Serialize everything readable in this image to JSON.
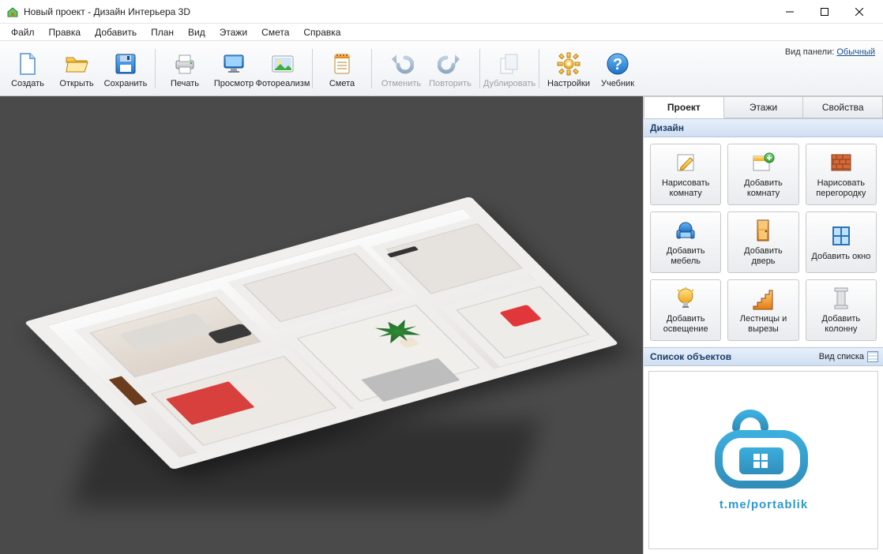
{
  "window": {
    "title": "Новый проект - Дизайн Интерьера 3D"
  },
  "menu": {
    "items": [
      {
        "label": "Файл"
      },
      {
        "label": "Правка"
      },
      {
        "label": "Добавить"
      },
      {
        "label": "План"
      },
      {
        "label": "Вид"
      },
      {
        "label": "Этажи"
      },
      {
        "label": "Смета"
      },
      {
        "label": "Справка"
      }
    ]
  },
  "toolbar": {
    "panel_mode_label": "Вид панели:",
    "panel_mode_value": "Обычный",
    "buttons": [
      {
        "id": "create",
        "label": "Создать",
        "icon": "file-new",
        "enabled": true
      },
      {
        "id": "open",
        "label": "Открыть",
        "icon": "folder-open",
        "enabled": true
      },
      {
        "id": "save",
        "label": "Сохранить",
        "icon": "floppy",
        "enabled": true
      },
      {
        "id": "sep"
      },
      {
        "id": "print",
        "label": "Печать",
        "icon": "printer",
        "enabled": true
      },
      {
        "id": "preview",
        "label": "Просмотр",
        "icon": "monitor",
        "enabled": true
      },
      {
        "id": "photoreal",
        "label": "Фотореализм",
        "icon": "photo",
        "enabled": true
      },
      {
        "id": "sep"
      },
      {
        "id": "estimate",
        "label": "Смета",
        "icon": "notepad",
        "enabled": true
      },
      {
        "id": "sep"
      },
      {
        "id": "undo",
        "label": "Отменить",
        "icon": "undo",
        "enabled": false
      },
      {
        "id": "redo",
        "label": "Повторить",
        "icon": "redo",
        "enabled": false
      },
      {
        "id": "sep"
      },
      {
        "id": "duplicate",
        "label": "Дублировать",
        "icon": "duplicate",
        "enabled": false
      },
      {
        "id": "sep"
      },
      {
        "id": "settings",
        "label": "Настройки",
        "icon": "gear",
        "enabled": true
      },
      {
        "id": "tutorial",
        "label": "Учебник",
        "icon": "help",
        "enabled": true
      }
    ]
  },
  "sidepanel": {
    "tabs": [
      {
        "label": "Проект",
        "active": true
      },
      {
        "label": "Этажи",
        "active": false
      },
      {
        "label": "Свойства",
        "active": false
      }
    ],
    "design_header": "Дизайн",
    "design_buttons": [
      {
        "id": "draw-room",
        "label": "Нарисовать комнату",
        "icon": "pencil-room"
      },
      {
        "id": "add-room",
        "label": "Добавить комнату",
        "icon": "add-room"
      },
      {
        "id": "draw-partition",
        "label": "Нарисовать перегородку",
        "icon": "brick-wall"
      },
      {
        "id": "add-furniture",
        "label": "Добавить мебель",
        "icon": "armchair"
      },
      {
        "id": "add-door",
        "label": "Добавить дверь",
        "icon": "door"
      },
      {
        "id": "add-window",
        "label": "Добавить окно",
        "icon": "window"
      },
      {
        "id": "add-light",
        "label": "Добавить освещение",
        "icon": "lightbulb"
      },
      {
        "id": "stairs-cutouts",
        "label": "Лестницы и вырезы",
        "icon": "stairs"
      },
      {
        "id": "add-column",
        "label": "Добавить колонну",
        "icon": "column"
      }
    ],
    "objects_header": "Список объектов",
    "list_mode_label": "Вид списка",
    "watermark_text": "t.me/portablik"
  }
}
